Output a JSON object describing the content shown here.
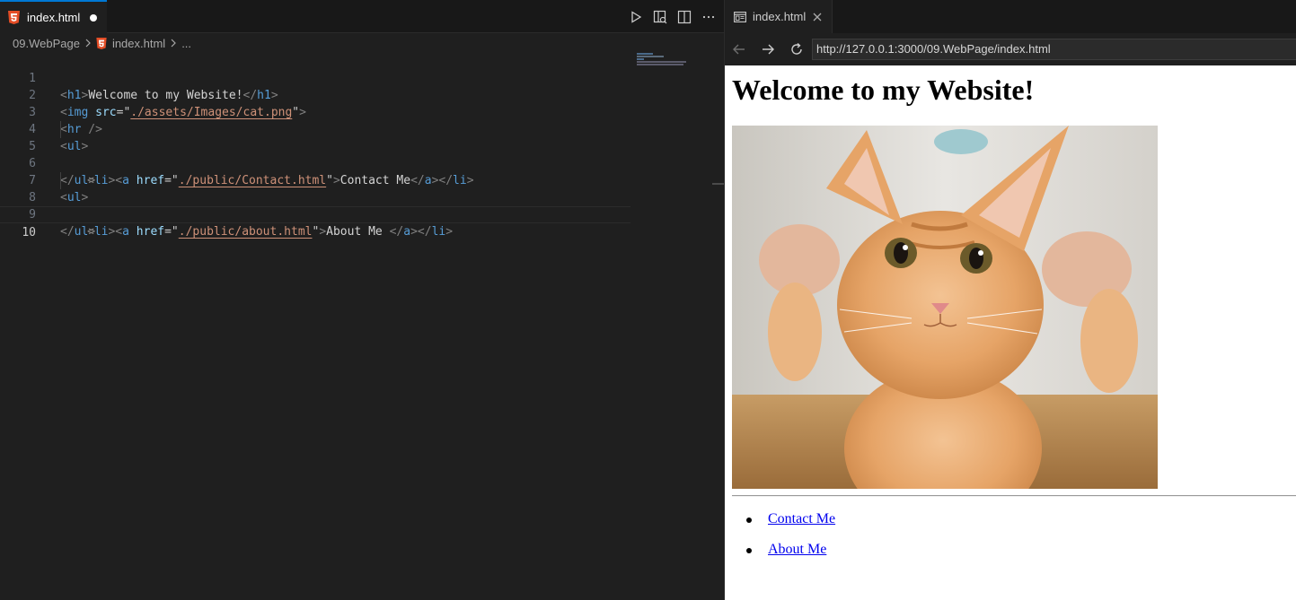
{
  "editor": {
    "tab": {
      "label": "index.html",
      "icon": "html5-icon"
    },
    "actions": [
      "run-icon",
      "open-preview-icon",
      "split-editor-icon",
      "more-actions-icon"
    ],
    "breadcrumb": {
      "folder": "09.WebPage",
      "file": "index.html",
      "ellipsis": "..."
    },
    "line_numbers": [
      "1",
      "2",
      "3",
      "4",
      "5",
      "6",
      "7",
      "8",
      "9",
      "10"
    ],
    "lines": [
      [
        "<",
        "h1",
        ">",
        "Welcome to my Website!",
        "</",
        "h1",
        ">"
      ],
      [
        "<",
        "img",
        " ",
        "src",
        "=\"",
        "./assets/Images/cat.png",
        "\"",
        ">"
      ],
      [
        "<",
        "hr",
        " />"
      ],
      [
        "<",
        "ul",
        ">"
      ],
      [
        "<",
        "li",
        "><",
        "a",
        " ",
        "href",
        "=\"",
        "./public/Contact.html",
        "\"",
        ">",
        "Contact Me",
        "</",
        "a",
        "></",
        "li",
        ">"
      ],
      [
        "</",
        "ul",
        ">"
      ],
      [
        "<",
        "ul",
        ">"
      ],
      [
        "<",
        "li",
        "><",
        "a",
        " ",
        "href",
        "=\"",
        "./public/about.html",
        "\"",
        ">",
        "About Me ",
        "</",
        "a",
        "></",
        "li",
        ">"
      ],
      [
        "</",
        "ul",
        ">"
      ],
      [
        ""
      ]
    ],
    "colors": {
      "tag": "#808080",
      "name": "#569cd6",
      "attr": "#9cdcfe",
      "string": "#ce9178",
      "text": "#d4d4d4",
      "accent": "#0078d4"
    }
  },
  "browser": {
    "tab": {
      "label": "index.html",
      "icon": "preview-icon"
    },
    "nav": [
      "back-icon",
      "forward-icon",
      "reload-icon"
    ],
    "url": "http://127.0.0.1:3000/09.WebPage/index.html",
    "page": {
      "heading": "Welcome to my Website!",
      "links": [
        "Contact Me",
        "About Me"
      ]
    }
  }
}
